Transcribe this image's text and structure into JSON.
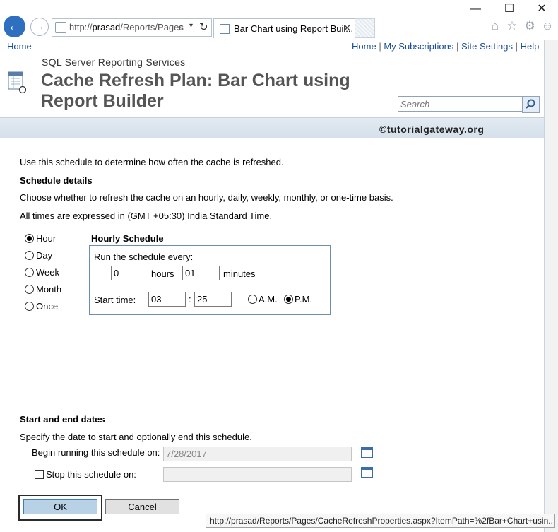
{
  "browser": {
    "window_controls": [
      "—",
      "☐",
      "✕"
    ],
    "address_prefix": "http://",
    "address_host": "prasad",
    "address_path": "/Reports/Pages",
    "tab_title": "Bar Chart using Report Buil..."
  },
  "topnav": {
    "home_left": "Home",
    "links": [
      "Home",
      "My Subscriptions",
      "Site Settings",
      "Help"
    ],
    "separator": "|"
  },
  "header": {
    "product": "SQL Server Reporting Services",
    "title": "Cache Refresh Plan: Bar Chart using Report Builder",
    "search_placeholder": "Search",
    "watermark": "©tutorialgateway.org"
  },
  "intro": "Use this schedule to determine how often the cache is refreshed.",
  "schedule_details": {
    "heading": "Schedule details",
    "line1": "Choose whether to refresh the cache on an hourly, daily, weekly, monthly, or one-time basis.",
    "line2": "All times are expressed in (GMT +05:30) India Standard Time."
  },
  "frequency_options": [
    {
      "label": "Hour",
      "selected": true
    },
    {
      "label": "Day",
      "selected": false
    },
    {
      "label": "Week",
      "selected": false
    },
    {
      "label": "Month",
      "selected": false
    },
    {
      "label": "Once",
      "selected": false
    }
  ],
  "hourly": {
    "heading": "Hourly Schedule",
    "run_label": "Run the schedule every:",
    "hours_value": "0",
    "hours_label": "hours",
    "minutes_value": "01",
    "minutes_label": "minutes",
    "start_label": "Start time:",
    "start_hour": "03",
    "colon": ":",
    "start_minute": "25",
    "am_label": "A.M.",
    "pm_label": "P.M.",
    "pm_selected": true
  },
  "dates": {
    "heading": "Start and end dates",
    "description": "Specify the date to start and optionally end this schedule.",
    "begin_label": "Begin running this schedule on:",
    "begin_value": "7/28/2017",
    "stop_label": "Stop this schedule on:",
    "stop_value": ""
  },
  "buttons": {
    "ok": "OK",
    "cancel": "Cancel"
  },
  "status_url": "http://prasad/Reports/Pages/CacheRefreshProperties.aspx?ItemPath=%2fBar+Chart+usin..."
}
